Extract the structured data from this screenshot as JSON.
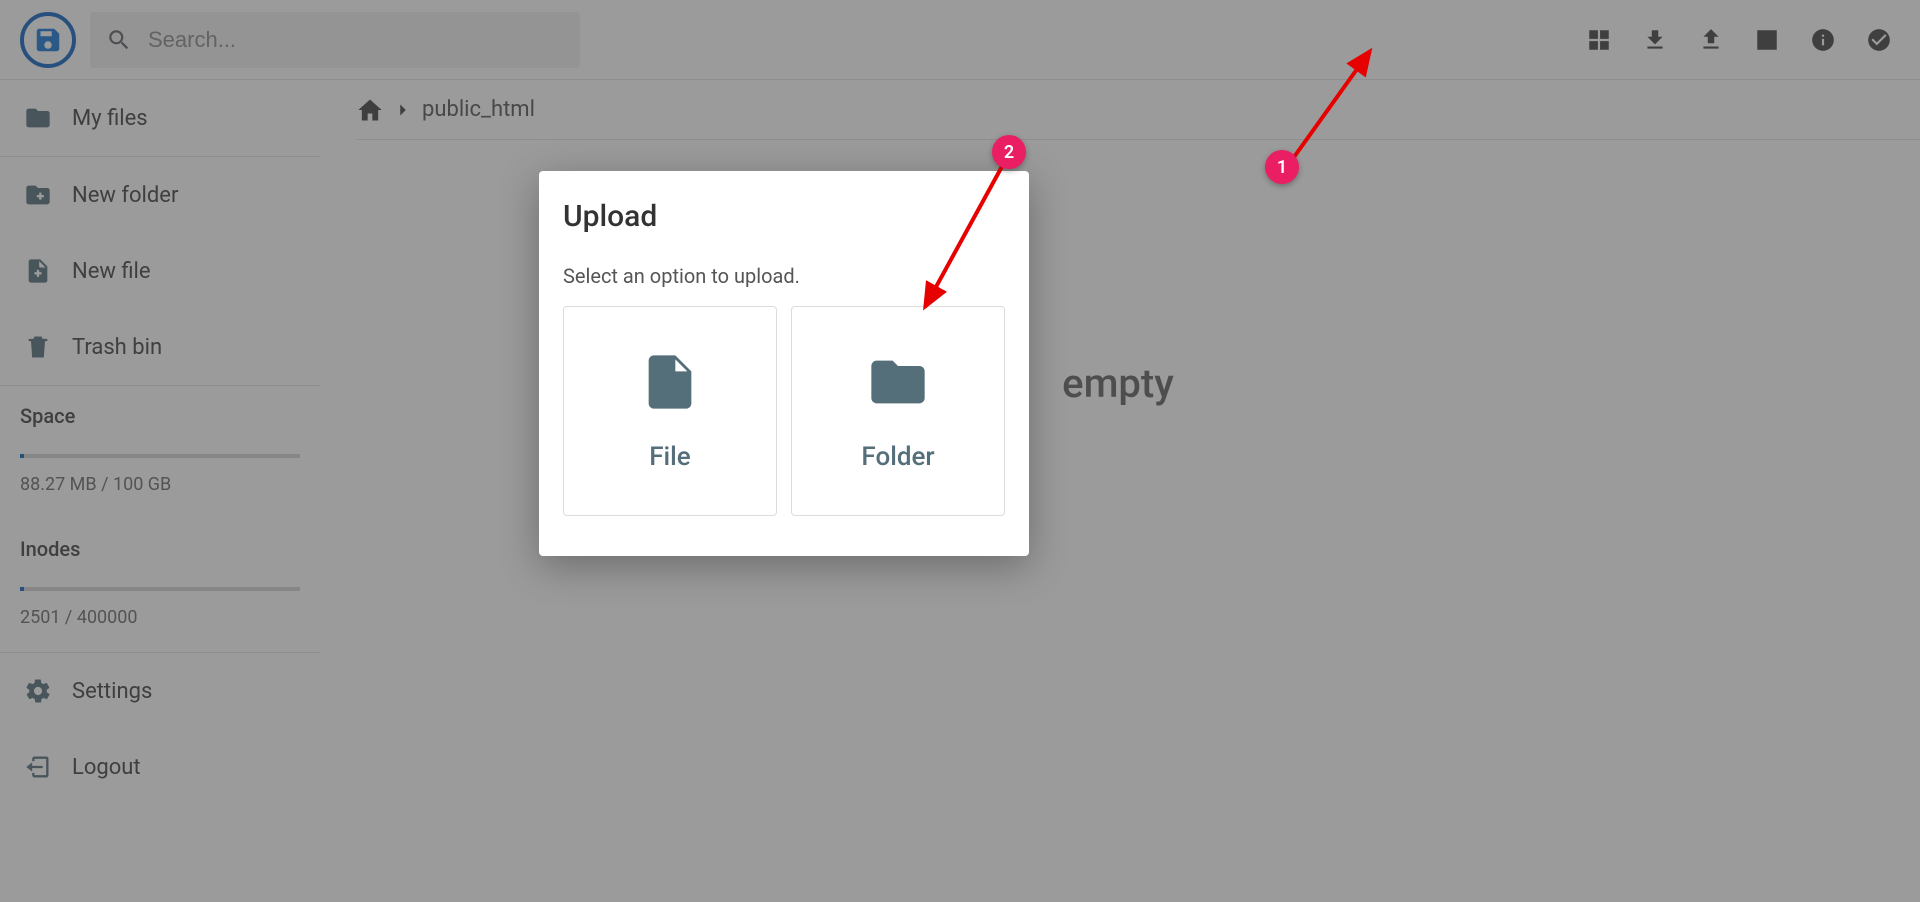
{
  "search": {
    "placeholder": "Search..."
  },
  "sidebar": {
    "items": [
      {
        "label": "My files"
      },
      {
        "label": "New folder"
      },
      {
        "label": "New file"
      },
      {
        "label": "Trash bin"
      }
    ],
    "space": {
      "heading": "Space",
      "metric": "88.27 MB / 100 GB"
    },
    "inodes": {
      "heading": "Inodes",
      "metric": "2501 / 400000"
    },
    "settings": "Settings",
    "logout": "Logout"
  },
  "breadcrumb": {
    "current": "public_html"
  },
  "main": {
    "empty": "empty"
  },
  "dialog": {
    "title": "Upload",
    "subtitle": "Select an option to upload.",
    "file": "File",
    "folder": "Folder"
  },
  "annotations": {
    "badge1": "1",
    "badge2": "2"
  }
}
